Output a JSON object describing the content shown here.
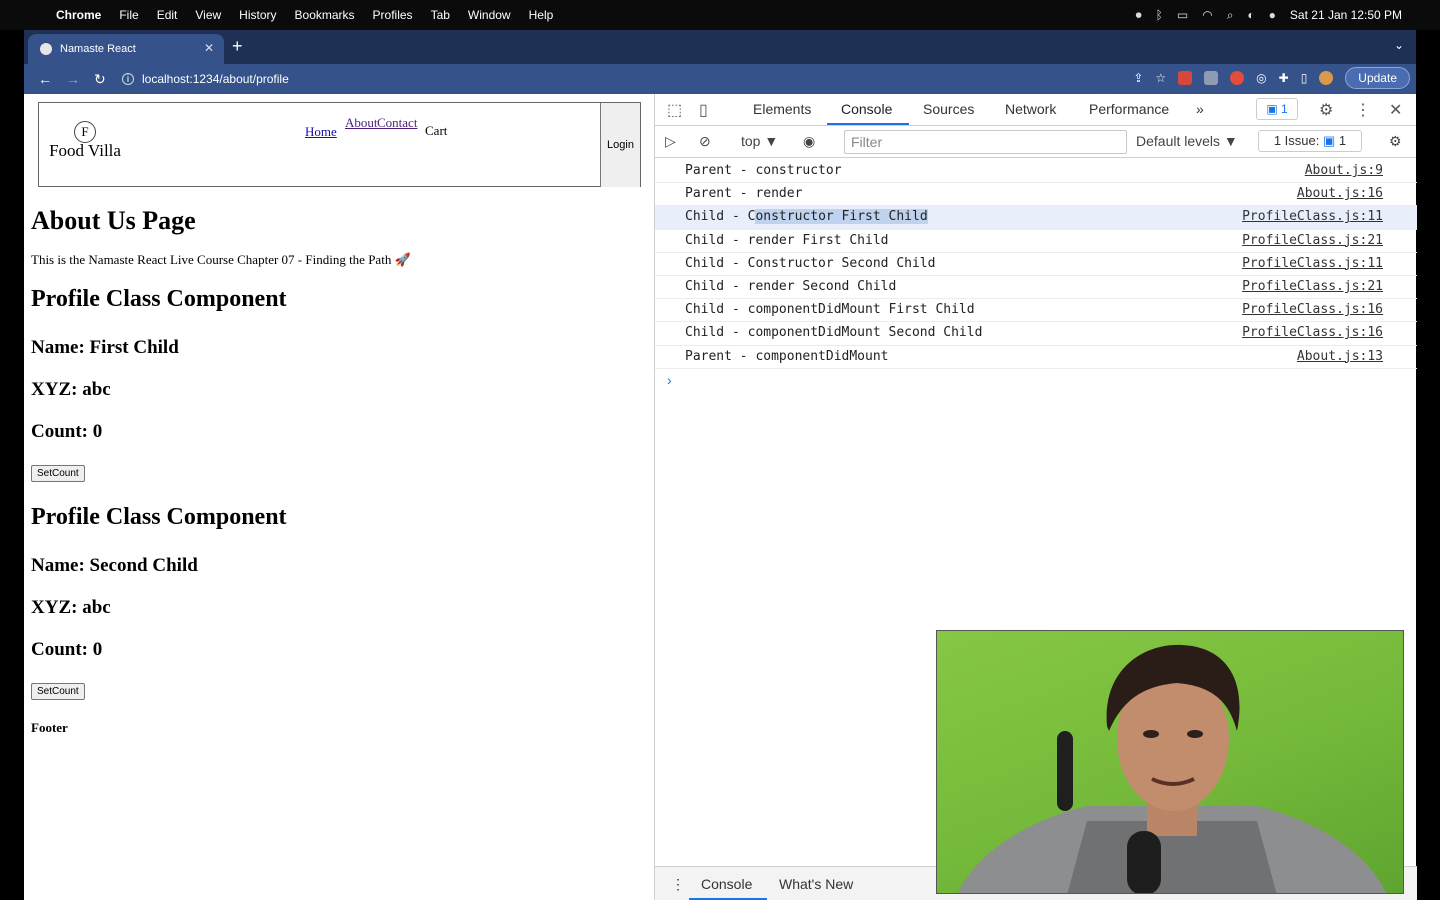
{
  "menubar": {
    "app": "Chrome",
    "items": [
      "File",
      "Edit",
      "View",
      "History",
      "Bookmarks",
      "Profiles",
      "Tab",
      "Window",
      "Help"
    ],
    "clock": "Sat 21 Jan  12:50 PM"
  },
  "browser": {
    "tab_title": "Namaste React",
    "url": "localhost:1234/about/profile",
    "update_label": "Update"
  },
  "page": {
    "logo_mark": "F",
    "logo_text": "Food Villa",
    "nav": {
      "home": "Home",
      "about": "About",
      "contact": "Contact",
      "cart": "Cart"
    },
    "login": "Login",
    "title": "About Us Page",
    "intro": "This is the Namaste React Live Course Chapter 07 - Finding the Path 🚀",
    "profiles": [
      {
        "heading": "Profile Class Component",
        "name": "Name: First Child",
        "xyz": "XYZ: abc",
        "count": "Count: 0",
        "button": "SetCount"
      },
      {
        "heading": "Profile Class Component",
        "name": "Name: Second Child",
        "xyz": "XYZ: abc",
        "count": "Count: 0",
        "button": "SetCount"
      }
    ],
    "footer": "Footer"
  },
  "devtools": {
    "tabs": [
      "Elements",
      "Console",
      "Sources",
      "Network",
      "Performance"
    ],
    "active_tab": "Console",
    "messages_badge": "1",
    "context": "top ▼",
    "filter_placeholder": "Filter",
    "levels": "Default levels ▼",
    "issues": "1 Issue:",
    "issues_count": "1",
    "logs": [
      {
        "msg": "Parent - constructor",
        "src": "About.js:9"
      },
      {
        "msg": "Parent - render",
        "src": "About.js:16"
      },
      {
        "msg_pre": "Child - C",
        "msg_hl": "onstructor First Child",
        "src": "ProfileClass.js:11"
      },
      {
        "msg": "Child - render First Child",
        "src": "ProfileClass.js:21"
      },
      {
        "msg": "Child - Constructor Second Child",
        "src": "ProfileClass.js:11"
      },
      {
        "msg": "Child - render Second Child",
        "src": "ProfileClass.js:21"
      },
      {
        "msg": "Child - componentDidMount First Child",
        "src": "ProfileClass.js:16"
      },
      {
        "msg": "Child - componentDidMount Second Child",
        "src": "ProfileClass.js:16"
      },
      {
        "msg": "Parent - componentDidMount",
        "src": "About.js:13"
      }
    ],
    "drawer_tabs": [
      "Console",
      "What's New"
    ]
  }
}
